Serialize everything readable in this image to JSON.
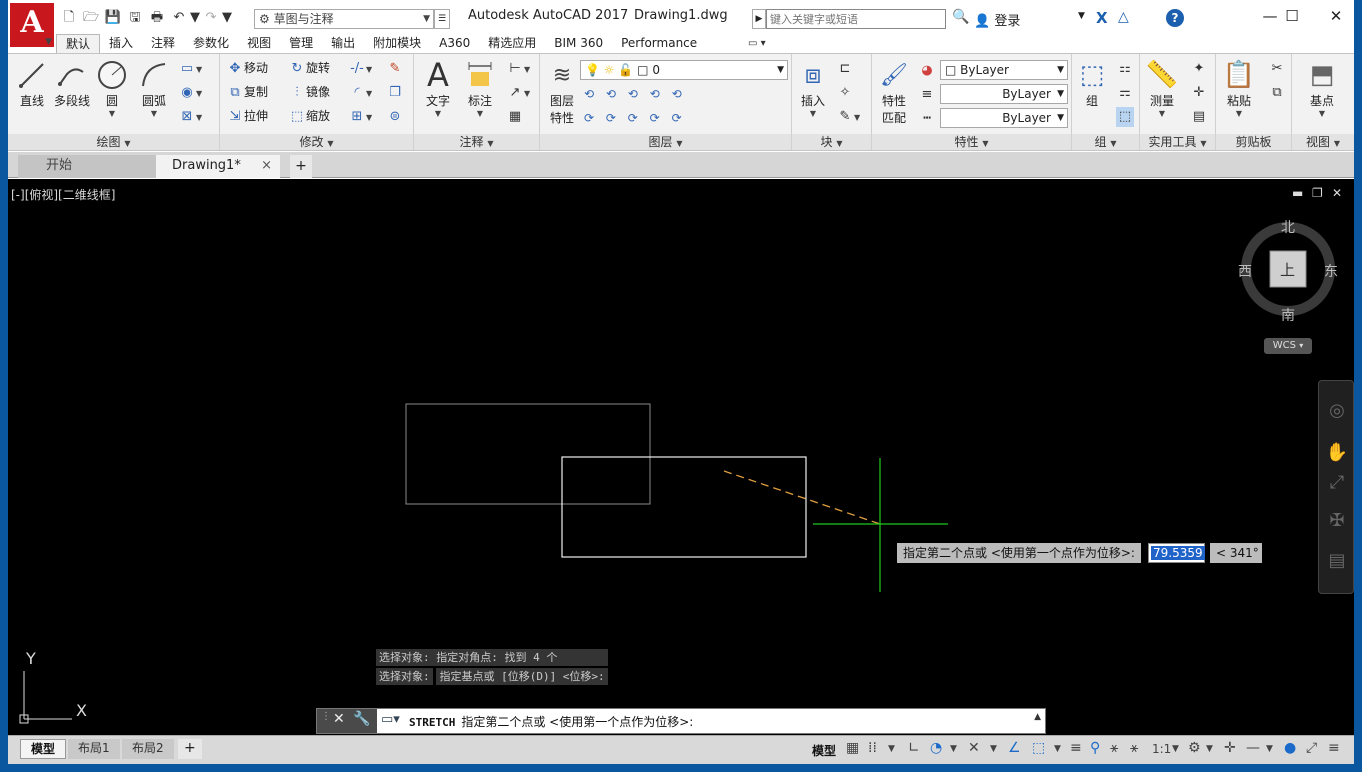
{
  "window": {
    "app_title": "Autodesk AutoCAD 2017",
    "doc_title": "Drawing1.dwg",
    "logo_letter": "A",
    "workspace": "草图与注释",
    "search_placeholder": "键入关键字或短语",
    "login_label": "登录",
    "help_label": "?"
  },
  "ribbon_tabs": [
    "默认",
    "插入",
    "注释",
    "参数化",
    "视图",
    "管理",
    "输出",
    "附加模块",
    "A360",
    "精选应用",
    "BIM 360",
    "Performance"
  ],
  "ribbon": {
    "draw": {
      "title": "绘图",
      "line": "直线",
      "polyline": "多段线",
      "circle": "圆",
      "arc": "圆弧"
    },
    "modify": {
      "title": "修改",
      "move": "移动",
      "rotate": "旋转",
      "copy": "复制",
      "mirror": "镜像",
      "stretch": "拉伸",
      "scale": "缩放"
    },
    "annotation": {
      "title": "注释",
      "text": "文字",
      "dimension": "标注"
    },
    "layers": {
      "title": "图层",
      "layer_properties_1": "图层",
      "layer_properties_2": "特性",
      "current_layer": "0"
    },
    "block": {
      "title": "块",
      "insert": "插入"
    },
    "properties": {
      "title": "特性",
      "match_1": "特性",
      "match_2": "匹配",
      "color": "ByLayer",
      "linetype": "ByLayer",
      "lineweight": "ByLayer"
    },
    "groups": {
      "title": "组",
      "group": "组"
    },
    "utilities": {
      "title": "实用工具",
      "measure": "测量"
    },
    "clipboard": {
      "title": "剪贴板",
      "paste": "粘贴"
    },
    "view": {
      "title": "视图",
      "base": "基点"
    }
  },
  "doc_tabs": {
    "start": "开始",
    "drawing": "Drawing1*",
    "close": "×",
    "add": "+"
  },
  "viewport": {
    "label": "[-][俯视][二维线框]",
    "compass": {
      "north": "北",
      "south": "南",
      "east": "东",
      "west": "西",
      "top": "上"
    },
    "wcs": "WCS",
    "ucs_x": "X",
    "ucs_y": "Y"
  },
  "dynamic_input": {
    "prompt": "指定第二个点或 <使用第一个点作为位移>:",
    "distance": "79.5359",
    "angle": "< 341°"
  },
  "command_history": [
    "选择对象: 指定对角点: 找到 4 个",
    "选择对象:",
    "指定基点或 [位移(D)] <位移>:"
  ],
  "command_line": {
    "command": "STRETCH",
    "prompt": "指定第二个点或 <使用第一个点作为位移>:"
  },
  "layout_tabs": [
    "模型",
    "布局1",
    "布局2"
  ],
  "status": {
    "model_label": "模型",
    "scale": "1:1"
  }
}
